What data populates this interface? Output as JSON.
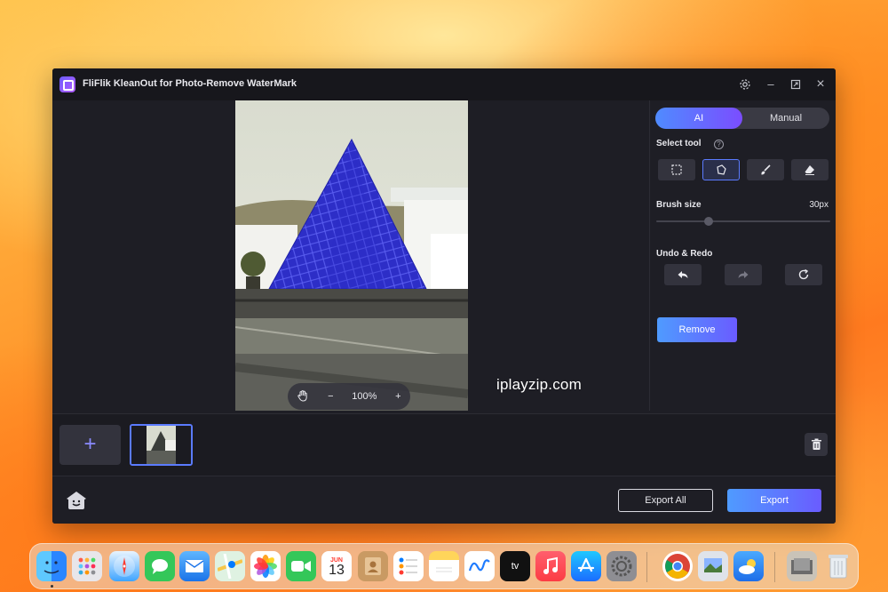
{
  "window": {
    "title": "FliFlik KleanOut for Photo-Remove WaterMark",
    "controls": {
      "settings": "settings-icon",
      "minimize": "–",
      "maximize": "maximize-icon",
      "close": "×"
    }
  },
  "canvas": {
    "zoom_level": "100%",
    "zoom_minus": "−",
    "zoom_plus": "+",
    "watermark_text": "iplayzip.com"
  },
  "panel": {
    "modes": {
      "ai": "AI",
      "manual": "Manual",
      "selected": "AI"
    },
    "select_tool_label": "Select tool",
    "help": "?",
    "tools": [
      "rectangle-select",
      "lasso-select",
      "brush",
      "eraser"
    ],
    "selected_tool": "lasso-select",
    "brush_size_label": "Brush size",
    "brush_size_value": "30px",
    "brush_size_fraction": 0.3,
    "undo_redo_label": "Undo & Redo",
    "remove_label": "Remove"
  },
  "strip": {
    "add_label": "+"
  },
  "bottom": {
    "export_all_label": "Export All",
    "export_label": "Export"
  },
  "dock": {
    "calendar_month": "JUN",
    "calendar_day": "13",
    "tv_label": "tv"
  },
  "colors": {
    "accent_gradient_start": "#4f9bff",
    "accent_gradient_end": "#6a5cff",
    "highlight_mask": "#2a2bc9",
    "window_bg": "#1e1e25"
  }
}
